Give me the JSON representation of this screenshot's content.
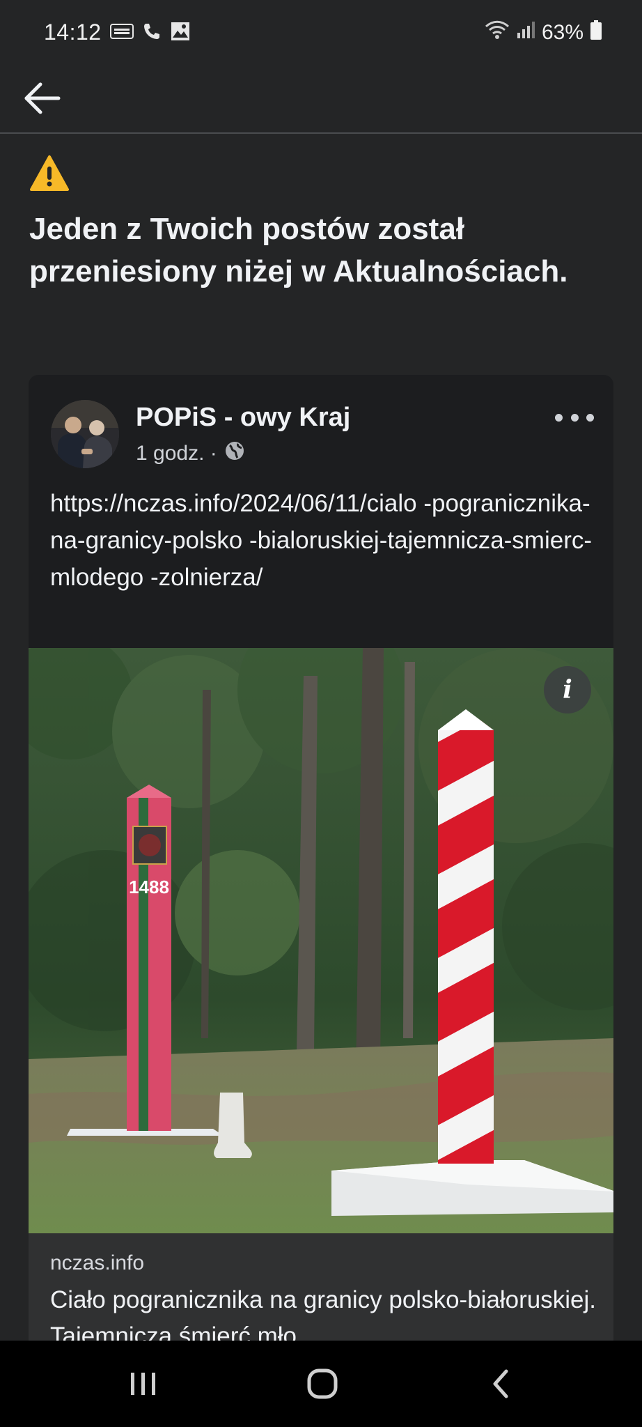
{
  "status_bar": {
    "time": "14:12",
    "battery": "63%",
    "icons": [
      "temu-icon",
      "wifi-call-icon",
      "gallery-icon",
      "wifi-icon",
      "signal-icon",
      "battery-icon"
    ]
  },
  "notice": {
    "icon": "warning-icon",
    "title": "Jeden z Twoich postów został przeniesiony niżej w Aktualnościach."
  },
  "post": {
    "author": "POPiS - owy Kraj",
    "time": "1 godz. ·",
    "privacy_icon": "globe-icon",
    "text": "https://nczas.info/2024/06/11/cialo -pogranicznika-na-granicy-polsko -bialoruskiej-tajemnicza-smierc-mlodego -zolnierza/",
    "image_marker_number": "1488",
    "info_label": "i"
  },
  "link_preview": {
    "domain": "nczas.info",
    "title": "Ciało pogranicznika na granicy polsko-białoruskiej. Tajemnicza śmierć mło"
  },
  "colors": {
    "background": "#242526",
    "card": "#1c1d1f",
    "preview": "#303132",
    "warning": "#f7b928",
    "red": "#d9192a"
  }
}
